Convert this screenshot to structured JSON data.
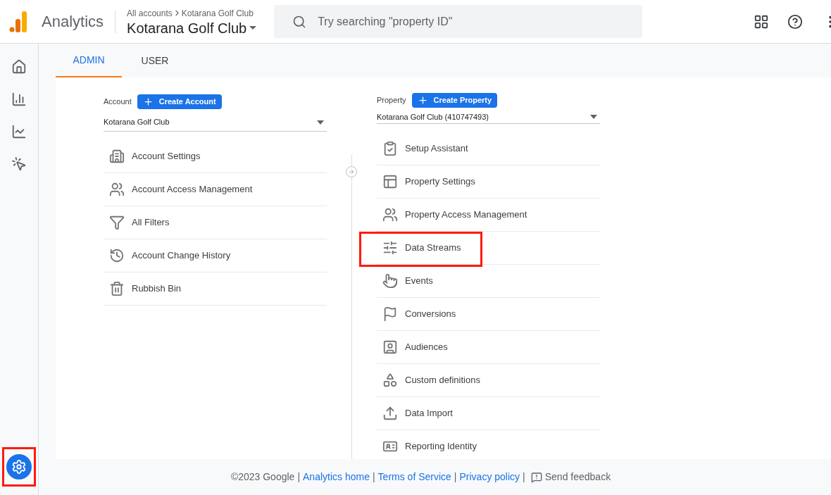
{
  "header": {
    "app_name": "Analytics",
    "breadcrumb": [
      "All accounts",
      "Kotarana Golf Club"
    ],
    "current_property": "Kotarana Golf Club",
    "search": {
      "placeholder": "Try searching \"property ID\""
    }
  },
  "sidebar": {
    "items": [
      {
        "kind": "home",
        "selected": false
      },
      {
        "kind": "reports",
        "selected": false
      },
      {
        "kind": "explore",
        "selected": false
      },
      {
        "kind": "advertising",
        "selected": false
      }
    ],
    "settings": {
      "selected": true,
      "highlighted": true
    }
  },
  "tabs": [
    {
      "label": "ADMIN",
      "selected": true
    },
    {
      "label": "USER",
      "selected": false
    }
  ],
  "account": {
    "label": "Account",
    "button": "Create Account",
    "value": "Kotarana Golf Club",
    "items": [
      {
        "kind": "building",
        "label": "Account Settings",
        "highlighted": false
      },
      {
        "kind": "people",
        "label": "Account Access Management",
        "highlighted": false
      },
      {
        "kind": "filter",
        "label": "All Filters",
        "highlighted": false
      },
      {
        "kind": "history",
        "label": "Account Change History",
        "highlighted": false
      },
      {
        "kind": "trash",
        "label": "Rubbish Bin",
        "highlighted": false
      }
    ]
  },
  "property": {
    "label": "Property",
    "button": "Create Property",
    "value": "Kotarana Golf Club (410747493)",
    "items": [
      {
        "kind": "checklist",
        "label": "Setup Assistant",
        "highlighted": false
      },
      {
        "kind": "layout",
        "label": "Property Settings",
        "highlighted": false
      },
      {
        "kind": "people",
        "label": "Property Access Management",
        "highlighted": false
      },
      {
        "kind": "streams",
        "label": "Data Streams",
        "highlighted": true
      },
      {
        "kind": "touch",
        "label": "Events",
        "highlighted": false
      },
      {
        "kind": "flag",
        "label": "Conversions",
        "highlighted": false
      },
      {
        "kind": "audience",
        "label": "Audiences",
        "highlighted": false
      },
      {
        "kind": "shapes",
        "label": "Custom definitions",
        "highlighted": false
      },
      {
        "kind": "upload",
        "label": "Data Import",
        "highlighted": false
      },
      {
        "kind": "identity",
        "label": "Reporting Identity",
        "highlighted": false
      }
    ]
  },
  "footer": {
    "items": [
      {
        "kind": "text",
        "text": "©2023 Google"
      },
      {
        "kind": "separator",
        "text": "|"
      },
      {
        "kind": "link",
        "text": "Analytics home"
      },
      {
        "kind": "separator",
        "text": "|"
      },
      {
        "kind": "link",
        "text": "Terms of Service"
      },
      {
        "kind": "separator",
        "text": "|"
      },
      {
        "kind": "link",
        "text": "Privacy policy"
      },
      {
        "kind": "separator",
        "text": "|"
      }
    ],
    "feedback": "Send feedback"
  }
}
